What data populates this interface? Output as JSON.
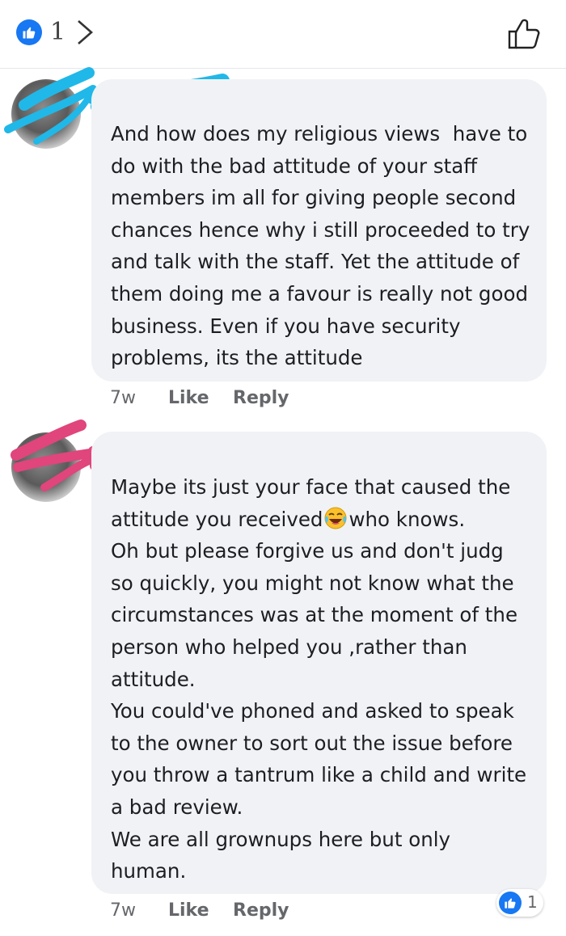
{
  "header": {
    "like_count": "1",
    "like_badge_icon": "thumbs-up-icon",
    "chevron_icon": "chevron-right-icon",
    "like_button_icon": "thumbs-up-outline-icon",
    "accent": "#1877f2"
  },
  "comments": [
    {
      "author_name": "",
      "text": "And how does my religious views  have to do with the bad attitude of your staff members im all for giving people second chances hence why i still proceeded to try and talk with the staff. Yet the attitude of them doing me a favour is really not good business. Even if you have security problems, its the attitude",
      "time": "7w",
      "like_label": "Like",
      "reply_label": "Reply",
      "redaction_color": "#20b8e8"
    },
    {
      "author_name": "",
      "text_before_emoji": "Maybe its just your face that caused the attitude you received",
      "emoji": "laughing-crying-emoji",
      "text_after_emoji": "who knows.\nOh but please forgive us and don't judg so quickly, you might not know what the circumstances was at the moment of the person who helped you ,rather than attitude.\nYou could've phoned and asked to speak to the owner to sort out the issue before you throw a tantrum like a child and write a bad review.\nWe are all grownups here but only human.",
      "time": "7w",
      "like_label": "Like",
      "reply_label": "Reply",
      "redaction_color": "#e0457b",
      "reaction_count": "1"
    }
  ]
}
